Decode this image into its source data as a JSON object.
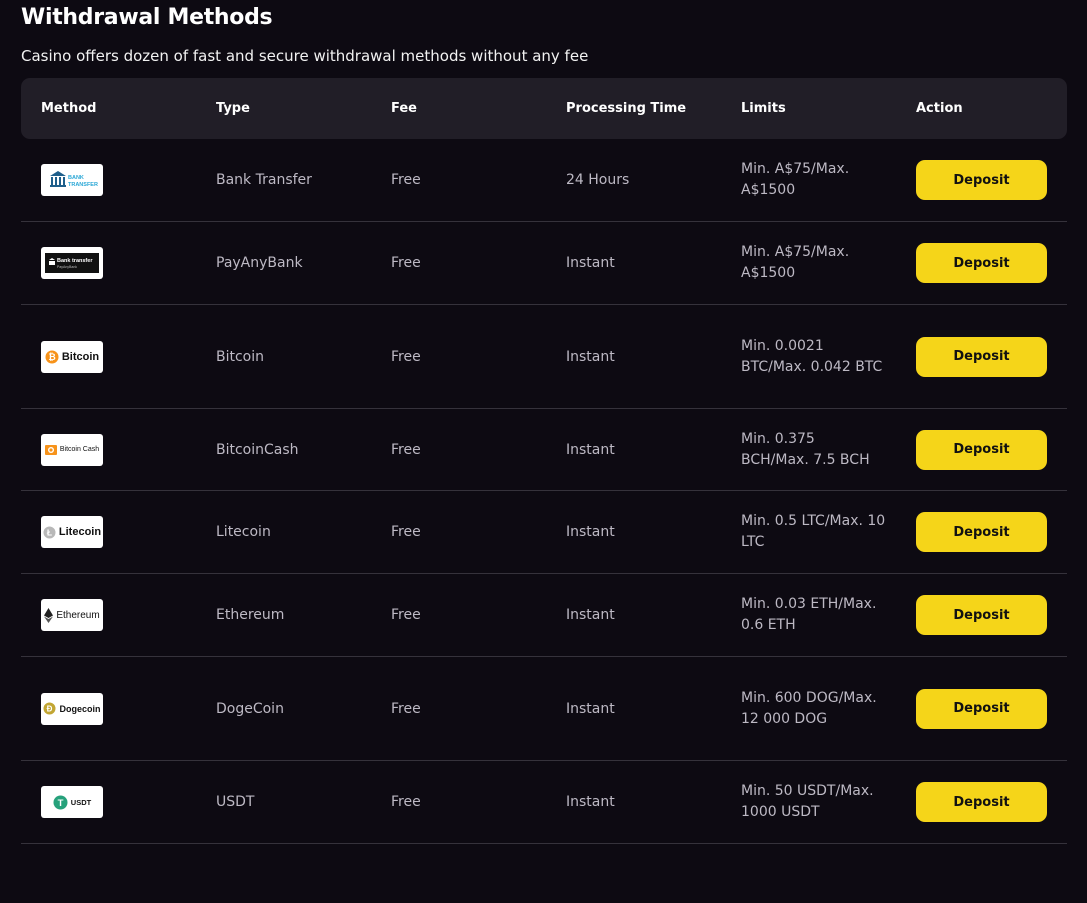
{
  "header": {
    "title": "Withdrawal Methods",
    "subtitle": "Casino offers dozen of fast and secure withdrawal methods without any fee"
  },
  "colors": {
    "background": "#0d0a12",
    "table_header_bg": "#211e27",
    "button_bg": "#f5d519",
    "row_divider": "#35323b"
  },
  "table": {
    "headers": [
      "Method",
      "Type",
      "Fee",
      "Processing Time",
      "Limits",
      "Action"
    ],
    "rows": [
      {
        "logo_icon": "bank-transfer-logo-icon",
        "logo_text_1": "BANK",
        "logo_text_2": "TRANSFER",
        "type": "Bank Transfer",
        "fee": "Free",
        "time": "24 Hours",
        "limits": "Min. A$75/Max. A$1500",
        "action": "Deposit"
      },
      {
        "logo_icon": "payanybank-logo-icon",
        "logo_text_1": "Bank transfer",
        "logo_text_2": "PayAnyBank",
        "type": "PayAnyBank",
        "fee": "Free",
        "time": "Instant",
        "limits": "Min. A$75/Max. A$1500",
        "action": "Deposit"
      },
      {
        "logo_icon": "bitcoin-logo-icon",
        "logo_text_1": "Bitcoin",
        "type": "Bitcoin",
        "fee": "Free",
        "time": "Instant",
        "limits": "Min. 0.0021 BTC/Max. 0.042 BTC",
        "action": "Deposit"
      },
      {
        "logo_icon": "bitcoin-cash-logo-icon",
        "logo_text_1": "Bitcoin Cash",
        "type": "BitcoinCash",
        "fee": "Free",
        "time": "Instant",
        "limits": "Min. 0.375 BCH/Max. 7.5 BCH",
        "action": "Deposit"
      },
      {
        "logo_icon": "litecoin-logo-icon",
        "logo_text_1": "Litecoin",
        "type": "Litecoin",
        "fee": "Free",
        "time": "Instant",
        "limits": "Min. 0.5 LTC/Max. 10 LTC",
        "action": "Deposit"
      },
      {
        "logo_icon": "ethereum-logo-icon",
        "logo_text_1": "Ethereum",
        "type": "Ethereum",
        "fee": "Free",
        "time": "Instant",
        "limits": "Min. 0.03 ETH/Max. 0.6 ETH",
        "action": "Deposit"
      },
      {
        "logo_icon": "dogecoin-logo-icon",
        "logo_text_1": "Dogecoin",
        "type": "DogeCoin",
        "fee": "Free",
        "time": "Instant",
        "limits": "Min. 600 DOG/Max. 12 000 DOG",
        "action": "Deposit"
      },
      {
        "logo_icon": "usdt-logo-icon",
        "logo_text_1": "USDT",
        "type": "USDT",
        "fee": "Free",
        "time": "Instant",
        "limits": "Min. 50 USDT/Max. 1000 USDT",
        "action": "Deposit"
      }
    ]
  }
}
